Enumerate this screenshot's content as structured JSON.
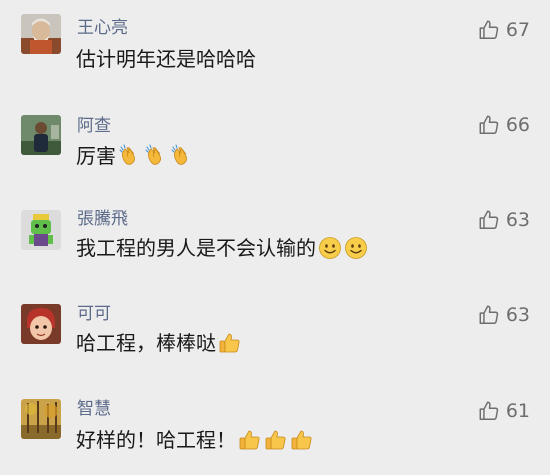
{
  "comments": [
    {
      "name": "王心亮",
      "text": "估计明年还是哈哈哈",
      "likes": "67",
      "avatar_icon": "elder-portrait-avatar",
      "emoji": []
    },
    {
      "name": "阿查",
      "text": "厉害",
      "likes": "66",
      "avatar_icon": "person-outdoor-avatar",
      "emoji": [
        "clapping-hands-emoji",
        "clapping-hands-emoji",
        "clapping-hands-emoji"
      ]
    },
    {
      "name": "張騰飛",
      "text": "我工程的男人是不会认输的",
      "likes": "63",
      "avatar_icon": "green-toy-figure-avatar",
      "emoji": [
        "smile-emoji",
        "smile-emoji"
      ]
    },
    {
      "name": "可可",
      "text": "哈工程，棒棒哒",
      "likes": "63",
      "avatar_icon": "cartoon-child-avatar",
      "emoji": [
        "thumbs-up-emoji"
      ]
    },
    {
      "name": "智慧",
      "text": "好样的！哈工程！",
      "likes": "61",
      "avatar_icon": "autumn-forest-avatar",
      "emoji": [
        "thumbs-up-emoji",
        "thumbs-up-emoji",
        "thumbs-up-emoji"
      ]
    }
  ],
  "colors": {
    "background": "#ededed",
    "name": "#5c6b8a",
    "text": "#191919",
    "like": "#6e6e6e"
  }
}
